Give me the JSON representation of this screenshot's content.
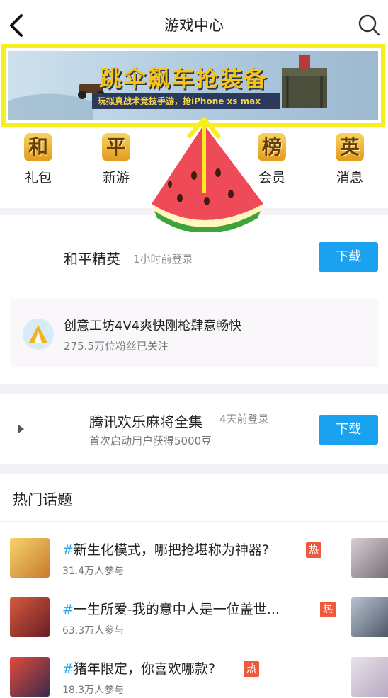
{
  "header": {
    "title": "游戏中心",
    "back_icon": "back-arrow-icon",
    "search_icon": "search-icon"
  },
  "banner": {
    "headline": "跳伞飙车抢装备",
    "subline": "玩拟真战术竞技手游，抢iPhone xs max",
    "highlight_color": "#f7ee1d"
  },
  "icon_row": [
    {
      "glyph": "和",
      "label": "礼包"
    },
    {
      "glyph": "平",
      "label": "新游"
    },
    {
      "glyph": "榜",
      "label": "会员"
    },
    {
      "glyph": "英",
      "label": "消息"
    }
  ],
  "card1": {
    "game_name": "和平精英",
    "login_time": "1小时前登录",
    "download_label": "下载",
    "creative_title": "创意工坊4V4爽快刚枪肆意畅快",
    "creative_sub": "275.5万位粉丝已关注"
  },
  "card2": {
    "game_name": "腾讯欢乐麻将全集",
    "login_time": "4天前登录",
    "subtitle": "首次启动用户获得5000豆",
    "download_label": "下载"
  },
  "hot_topics": {
    "title": "热门话题",
    "hash": "#",
    "hot_badge": "热",
    "items": [
      {
        "title": "新生化模式，哪把抢堪称为神器?",
        "count": "31.4万人参与"
      },
      {
        "title": "一生所爱-我的意中人是一位盖世...",
        "count": "63.3万人参与"
      },
      {
        "title": "猪年限定，你喜欢哪款?",
        "count": "18.3万人参与"
      }
    ]
  },
  "colors": {
    "accent": "#1aa1f0",
    "hot": "#ef5a3c",
    "hash": "#22a7f2"
  }
}
